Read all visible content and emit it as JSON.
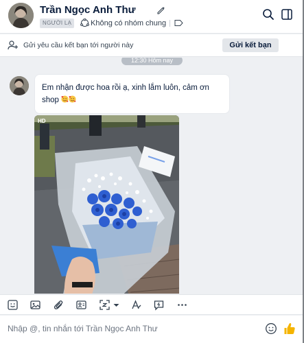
{
  "header": {
    "contact_name": "Trần Ngọc Anh Thư",
    "stranger_badge": "NGƯỜI LẠ",
    "common_groups": "Không có nhóm chung",
    "icons": [
      "edit-icon",
      "group-icon",
      "tag-icon",
      "search-icon",
      "panel-icon"
    ]
  },
  "friend_request": {
    "text": "Gửi yêu cầu kết bạn tới người này",
    "button_label": "Gửi kết bạn"
  },
  "conversation": {
    "time_divider": "12:30 Hôm nay",
    "messages": [
      {
        "type": "text",
        "line1": "Em nhận được hoa rồi ạ, xinh lắm luôn, cảm ơn",
        "line2": "shop",
        "emojis": [
          "smiling-face-with-hearts",
          "smiling-face-with-hearts"
        ]
      },
      {
        "type": "image",
        "badge": "HD",
        "description": "blue rose bouquet"
      }
    ]
  },
  "toolbar": {
    "tools": [
      "sticker-icon",
      "image-icon",
      "attachment-icon",
      "contact-card-icon",
      "screenshot-icon",
      "format-text-icon",
      "quick-message-icon",
      "more-icon"
    ]
  },
  "composer": {
    "placeholder": "Nhập @, tin nhắn tới Trần Ngọc Anh Thư"
  },
  "colors": {
    "accent": "#0068ff",
    "text": "#081b3a",
    "background": "#eef0f3",
    "like_yellow": "#f5b400"
  }
}
